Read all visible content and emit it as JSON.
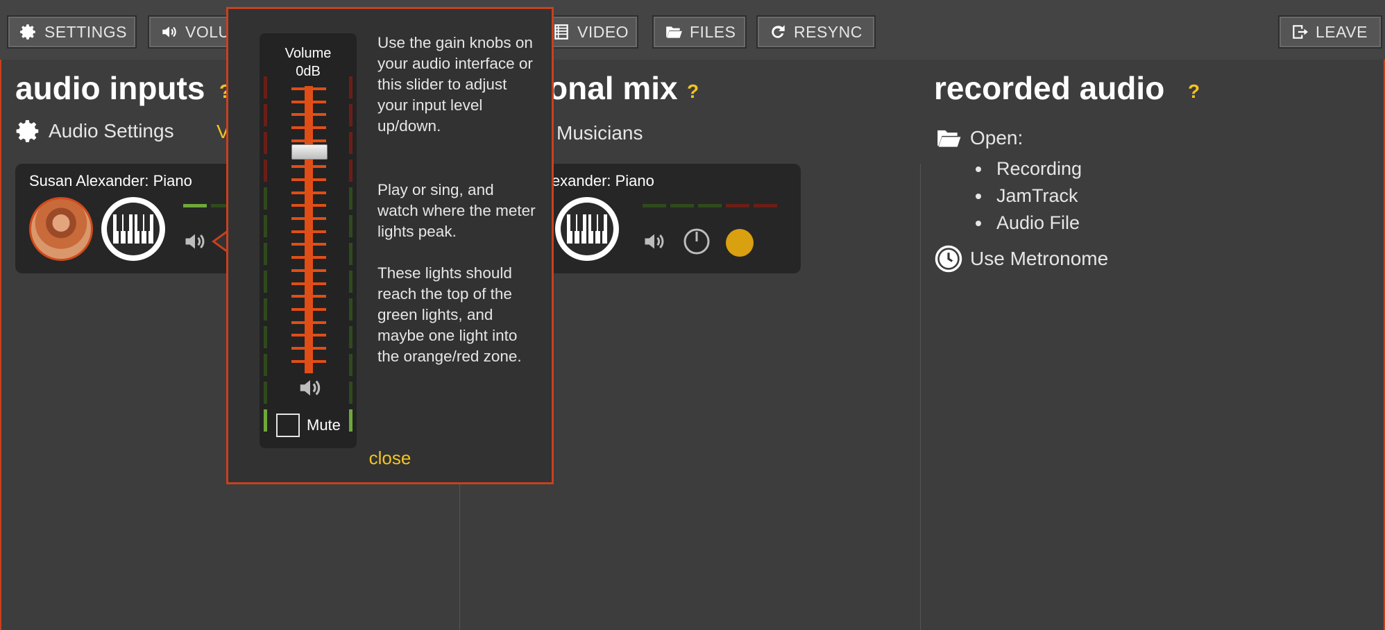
{
  "toolbar": {
    "settings": "SETTINGS",
    "volume": "VOLU",
    "video": "VIDEO",
    "files": "FILES",
    "resync": "RESYNC",
    "leave": "LEAVE"
  },
  "audio_inputs": {
    "title": "audio inputs",
    "help": "?",
    "settings_link": "Audio Settings",
    "partial_link": "V",
    "track_name": "Susan Alexander: Piano"
  },
  "personal_mix": {
    "title_partial": "onal mix",
    "help": "?",
    "musicians_link": "Musicians",
    "track_name_partial": "lexander: Piano"
  },
  "recorded_audio": {
    "title": "recorded audio",
    "help": "?",
    "open_label": "Open:",
    "items": [
      "Recording",
      "JamTrack",
      "Audio File"
    ],
    "metronome": "Use Metronome"
  },
  "volume_popup": {
    "fader_title": "Volume",
    "fader_value": "0dB",
    "mute_label": "Mute",
    "paragraph_1": "Use the gain knobs on your audio interface or this slider to adjust your input level up/down.",
    "paragraph_2": "Play or sing, and watch where the meter lights peak.",
    "paragraph_3": "These lights should reach the top of the green lights, and maybe one light into the orange/red zone.",
    "close": "close"
  },
  "colors": {
    "accent": "#c9401f",
    "help": "#f3c420",
    "fader": "#e04e17",
    "meter_green": "#6fa83a",
    "meter_green_dim": "#2f4a1c",
    "meter_red_dim": "#6b1e16",
    "status_dot": "#d9a00f"
  }
}
